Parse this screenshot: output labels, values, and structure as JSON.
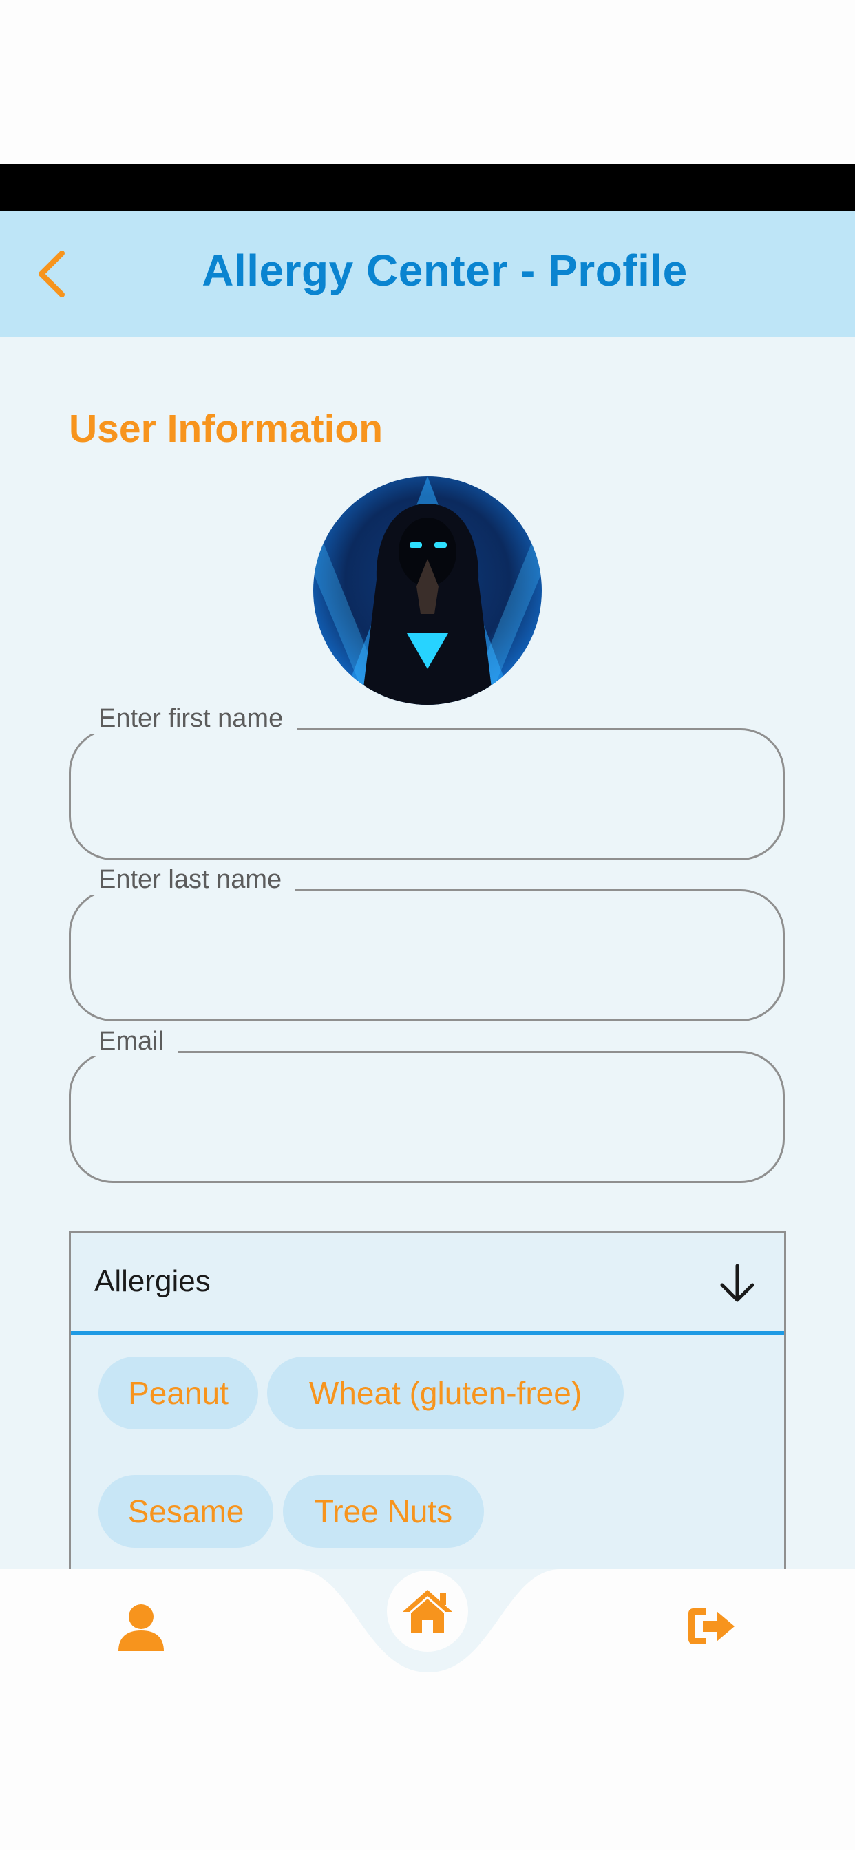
{
  "header": {
    "title": "Allergy Center - Profile",
    "back_icon": "chevron-left-icon"
  },
  "section": {
    "title": "User Information"
  },
  "avatar": {
    "description_icon": "hooded-figure-avatar"
  },
  "form": {
    "first_name": {
      "label": "Enter first name",
      "value": ""
    },
    "last_name": {
      "label": "Enter last name",
      "value": ""
    },
    "email": {
      "label": "Email",
      "value": ""
    }
  },
  "allergies": {
    "label": "Allergies",
    "expand_icon": "arrow-down-icon",
    "chips": [
      "Peanut",
      "Wheat (gluten-free)",
      "Sesame",
      "Tree Nuts"
    ]
  },
  "bottom_nav": {
    "items": [
      {
        "icon": "user-icon"
      },
      {
        "icon": "home-icon"
      },
      {
        "icon": "logout-icon"
      }
    ]
  },
  "colors": {
    "accent": "#f7941d",
    "primary": "#0a84d0",
    "app_bar": "#bee5f7",
    "background": "#ecf5f9",
    "underline": "#1e9ae4"
  }
}
